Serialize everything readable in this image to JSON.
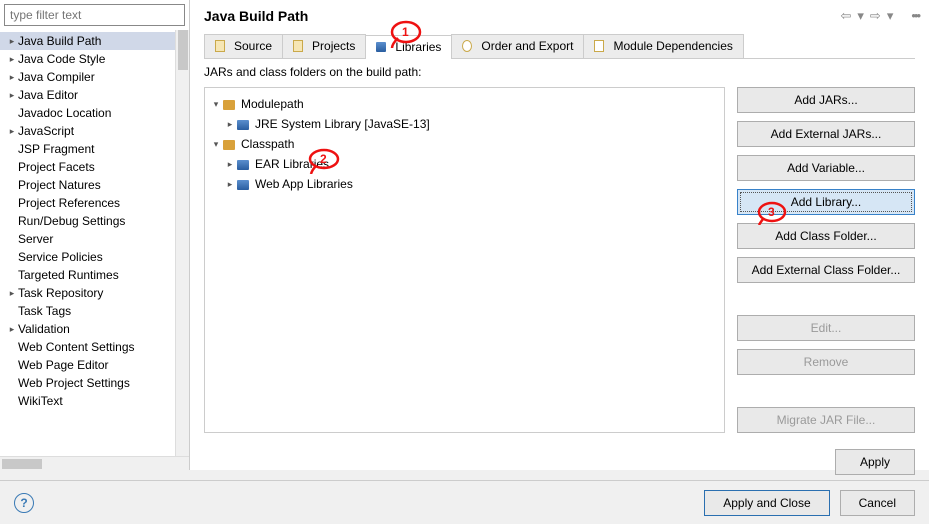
{
  "filter_placeholder": "type filter text",
  "sidebar": {
    "items": [
      {
        "label": "Java Build Path",
        "has_children": true,
        "indent": false,
        "selected": true
      },
      {
        "label": "Java Code Style",
        "has_children": true,
        "indent": false
      },
      {
        "label": "Java Compiler",
        "has_children": true,
        "indent": false
      },
      {
        "label": "Java Editor",
        "has_children": true,
        "indent": false
      },
      {
        "label": "Javadoc Location",
        "has_children": false,
        "indent": true
      },
      {
        "label": "JavaScript",
        "has_children": true,
        "indent": false
      },
      {
        "label": "JSP Fragment",
        "has_children": false,
        "indent": true
      },
      {
        "label": "Project Facets",
        "has_children": false,
        "indent": true
      },
      {
        "label": "Project Natures",
        "has_children": false,
        "indent": true
      },
      {
        "label": "Project References",
        "has_children": false,
        "indent": true
      },
      {
        "label": "Run/Debug Settings",
        "has_children": false,
        "indent": true
      },
      {
        "label": "Server",
        "has_children": false,
        "indent": true
      },
      {
        "label": "Service Policies",
        "has_children": false,
        "indent": true
      },
      {
        "label": "Targeted Runtimes",
        "has_children": false,
        "indent": true
      },
      {
        "label": "Task Repository",
        "has_children": true,
        "indent": false
      },
      {
        "label": "Task Tags",
        "has_children": false,
        "indent": true
      },
      {
        "label": "Validation",
        "has_children": true,
        "indent": false
      },
      {
        "label": "Web Content Settings",
        "has_children": false,
        "indent": true
      },
      {
        "label": "Web Page Editor",
        "has_children": false,
        "indent": true
      },
      {
        "label": "Web Project Settings",
        "has_children": false,
        "indent": true
      },
      {
        "label": "WikiText",
        "has_children": false,
        "indent": true
      }
    ]
  },
  "header": {
    "title": "Java Build Path"
  },
  "tabs": [
    {
      "label": "Source",
      "icon": "source"
    },
    {
      "label": "Projects",
      "icon": "projects"
    },
    {
      "label": "Libraries",
      "icon": "libraries",
      "active": true
    },
    {
      "label": "Order and Export",
      "icon": "order"
    },
    {
      "label": "Module Dependencies",
      "icon": "module"
    }
  ],
  "content": {
    "subtitle": "JARs and class folders on the build path:",
    "tree": {
      "modulepath_label": "Modulepath",
      "jre_label": "JRE System Library [JavaSE-13]",
      "classpath_label": "Classpath",
      "ear_label": "EAR Libraries",
      "webapp_label": "Web App Libraries"
    }
  },
  "buttons": {
    "add_jars": "Add JARs...",
    "add_ext_jars": "Add External JARs...",
    "add_variable": "Add Variable...",
    "add_library": "Add Library...",
    "add_class_folder": "Add Class Folder...",
    "add_ext_class_folder": "Add External Class Folder...",
    "edit": "Edit...",
    "remove": "Remove",
    "migrate": "Migrate JAR File...",
    "apply": "Apply"
  },
  "footer": {
    "apply_close": "Apply and Close",
    "cancel": "Cancel"
  },
  "annotations": {
    "one": "1",
    "two": "2",
    "three": "3"
  }
}
